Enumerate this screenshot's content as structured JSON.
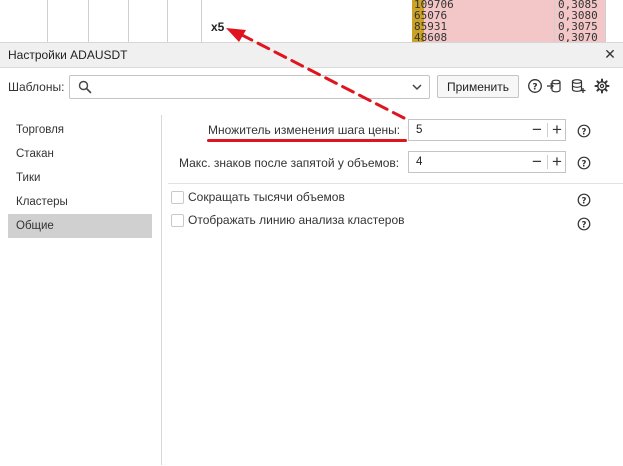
{
  "background_table": {
    "volumes": [
      "109706",
      "65076",
      "85931",
      "48608"
    ],
    "prices": [
      "0,3085",
      "0,3080",
      "0,3075",
      "0,3070"
    ],
    "highlight_label": "x5"
  },
  "dialog": {
    "title": "Настройки ADAUSDT",
    "close_symbol": "✕"
  },
  "toolbar": {
    "templates_label": "Шаблоны:",
    "search_placeholder": "",
    "search_value": "",
    "apply_label": "Применить"
  },
  "sidebar": {
    "items": [
      {
        "label": "Торговля",
        "active": false
      },
      {
        "label": "Стакан",
        "active": false
      },
      {
        "label": "Тики",
        "active": false
      },
      {
        "label": "Кластеры",
        "active": false
      },
      {
        "label": "Общие",
        "active": true
      }
    ]
  },
  "settings": {
    "price_step_multiplier": {
      "label": "Множитель изменения шага цены:",
      "value": "5"
    },
    "volume_decimals": {
      "label": "Макс. знаков после запятой у объемов:",
      "value": "4"
    },
    "shorten_thousands": {
      "label": "Сокращать тысячи объемов",
      "checked": false
    },
    "show_cluster_line": {
      "label": "Отображать линию анализа кластеров",
      "checked": false
    }
  },
  "stepper_symbols": {
    "minus": "−",
    "plus": "+"
  },
  "colors": {
    "annotation_red": "#e0141e",
    "active_nav_bg": "#d0d0d0",
    "volume_cell": "#c9a227",
    "price_cell": "#f3c7c7"
  }
}
